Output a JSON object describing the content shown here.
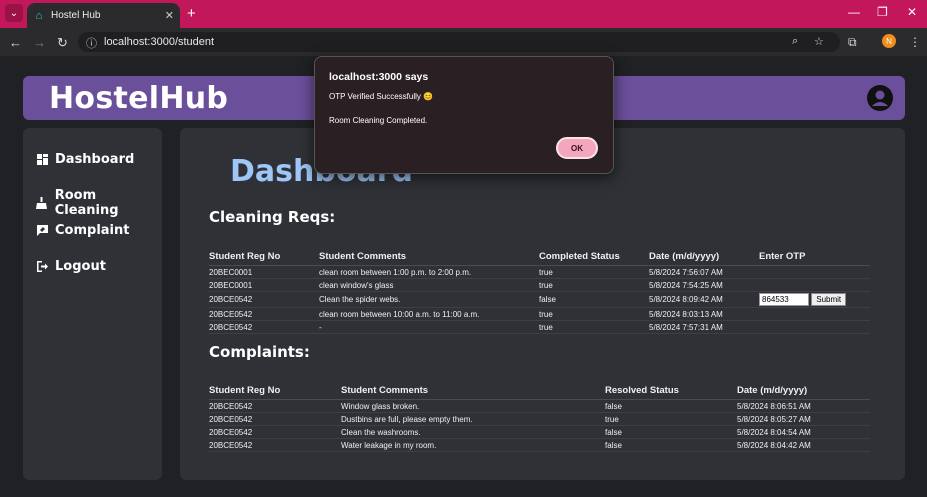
{
  "browser": {
    "tab_title": "Hostel Hub",
    "new_tab": "+",
    "url": "localhost:3000/student",
    "profile_initial": "N"
  },
  "header": {
    "logo": "HostelHub"
  },
  "sidebar": {
    "items": [
      {
        "label": "Dashboard",
        "icon": "dashboard-icon"
      },
      {
        "label": "Room Cleaning",
        "icon": "broom-icon"
      },
      {
        "label": "Complaint",
        "icon": "complaint-icon"
      },
      {
        "label": "Logout",
        "icon": "logout-icon"
      }
    ]
  },
  "main": {
    "title": "Dashboard",
    "cleaning": {
      "title": "Cleaning Reqs:",
      "headers": [
        "Student Reg No",
        "Student Comments",
        "Completed Status",
        "Date (m/d/yyyy)",
        "Enter OTP"
      ],
      "rows": [
        [
          "20BEC0001",
          "clean room between 1:00 p.m. to 2:00 p.m.",
          "true",
          "5/8/2024 7:56:07 AM"
        ],
        [
          "20BEC0001",
          "clean window's glass",
          "true",
          "5/8/2024 7:54:25 AM"
        ],
        [
          "20BCE0542",
          "Clean the spider webs.",
          "false",
          "5/8/2024 8:09:42 AM"
        ],
        [
          "20BCE0542",
          "clean room between 10:00 a.m. to 11:00 a.m.",
          "true",
          "5/8/2024 8:03:13 AM"
        ],
        [
          "20BCE0542",
          "-",
          "true",
          "5/8/2024 7:57:31 AM"
        ]
      ],
      "otp_value": "864533",
      "submit_label": "Submit"
    },
    "complaints": {
      "title": "Complaints:",
      "headers": [
        "Student Reg No",
        "Student Comments",
        "Resolved Status",
        "Date (m/d/yyyy)"
      ],
      "rows": [
        [
          "20BCE0542",
          "Window glass broken.",
          "false",
          "5/8/2024 8:06:51 AM"
        ],
        [
          "20BCE0542",
          "Dustbins are full, please empty them.",
          "true",
          "5/8/2024 8:05:27 AM"
        ],
        [
          "20BCE0542",
          "Clean the washrooms.",
          "false",
          "5/8/2024 8:04:54 AM"
        ],
        [
          "20BCE0542",
          "Water leakage in my room.",
          "false",
          "5/8/2024 8:04:42 AM"
        ]
      ]
    }
  },
  "dialog": {
    "title": "localhost:3000 says",
    "message1": "OTP Verified Successfully 😊",
    "message2": "Room Cleaning Completed.",
    "ok_label": "OK"
  },
  "colors": {
    "tabbar": "#c2185b",
    "header": "#6a4f9b",
    "panel": "#2f3136",
    "dashboard_title": "#9ec6f7",
    "ok_button": "#f4a7bc"
  }
}
